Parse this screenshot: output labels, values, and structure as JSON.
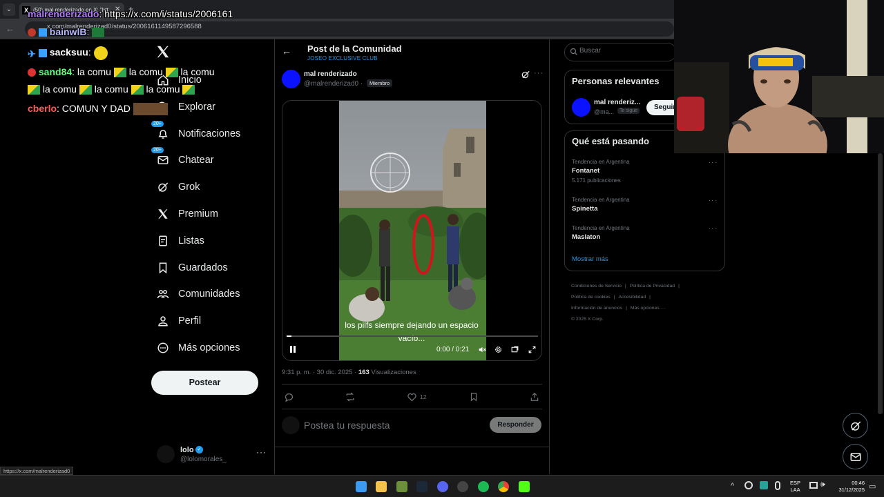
{
  "browser": {
    "tab_title": "(50) mal renderizado en X: \"htt",
    "tab_close": "✕",
    "tab_new": "+",
    "tab_menu": "⌄",
    "url": "x.com/malrenderizad0/status/2006161149587296588",
    "status_url": "https://x.com/malrenderizad0"
  },
  "chat": [
    {
      "user": "malrenderizado",
      "color": "#b57cff",
      "text": ": https://x.com/i/status/2006161"
    },
    {
      "user": "bainwlB",
      "color": "#b8b8ff",
      "text": ":"
    },
    {
      "user": "sacksuu",
      "color": "#ffffff",
      "text": ":"
    },
    {
      "user": "sand84",
      "color": "#5eff7a",
      "text": ": la comu",
      "repeat": [
        "la comu",
        "la comu"
      ]
    },
    {
      "user": "",
      "color": "#ffffff",
      "text": "la comu",
      "repeat": [
        "la comu",
        "la comu"
      ]
    },
    {
      "user": "cberlo",
      "color": "#ff5a5a",
      "text": ": COMUN Y DAD"
    }
  ],
  "nav": {
    "items": [
      {
        "label": "Inicio",
        "icon": "home-icon"
      },
      {
        "label": "Explorar",
        "icon": "explore-icon"
      },
      {
        "label": "Notificaciones",
        "icon": "bell-icon",
        "badge": "20+"
      },
      {
        "label": "Chatear",
        "icon": "mail-icon",
        "badge": "20+"
      },
      {
        "label": "Grok",
        "icon": "grok-icon"
      },
      {
        "label": "Premium",
        "icon": "x-premium-icon"
      },
      {
        "label": "Listas",
        "icon": "list-icon"
      },
      {
        "label": "Guardados",
        "icon": "bookmark-icon"
      },
      {
        "label": "Comunidades",
        "icon": "communities-icon"
      },
      {
        "label": "Perfil",
        "icon": "profile-icon"
      },
      {
        "label": "Más opciones",
        "icon": "more-options-icon"
      }
    ],
    "post_button": "Postear",
    "account": {
      "name": "lolo",
      "handle": "@lolomorales_",
      "more": "···"
    }
  },
  "header": {
    "back": "←",
    "title": "Post de la Comunidad",
    "subtitle": "JOSEO EXCLUSIVE CLUB"
  },
  "post": {
    "author": "mal renderizado",
    "handle": "@malrenderizad0 ·",
    "member_badge": "Miembro",
    "more": "···",
    "video": {
      "caption": "los pilfs siempre dejando un espacio vacío...",
      "time": "0:00 / 0:21",
      "progress": 0.02
    },
    "meta_time": "9:31 p. m. · 30 dic. 2025 · ",
    "views_count": "163",
    "views_label": " Visualizaciones",
    "likes": "12",
    "reply_placeholder": "Postea tu respuesta",
    "reply_button": "Responder"
  },
  "sidebar": {
    "search_placeholder": "Buscar",
    "relevant": {
      "title": "Personas relevantes",
      "name": "mal renderiz...",
      "handle": "@ma...",
      "follows_you": "Te sigue",
      "follow_button": "Seguir"
    },
    "trends": {
      "title": "Qué está pasando",
      "items": [
        {
          "context": "Tendencia en Argentina",
          "name": "Fontanet",
          "posts": "5.171 publicaciones"
        },
        {
          "context": "Tendencia en Argentina",
          "name": "Spinetta",
          "posts": ""
        },
        {
          "context": "Tendencia en Argentina",
          "name": "Maslaton",
          "posts": ""
        }
      ],
      "more": "···",
      "show_more": "Mostrar más"
    },
    "footer": {
      "links": [
        "Condiciones de Servicio",
        "Política de Privacidad",
        "Política de cookies",
        "Accesibilidad",
        "Información de anuncios",
        "Más opciones ···"
      ],
      "separator": "|",
      "copyright": "© 2025 X Corp."
    }
  },
  "taskbar": {
    "lang_top": "ESP",
    "lang_bottom": "LAA",
    "time": "00:46",
    "date": "31/12/2025",
    "tray_up": "^"
  },
  "colors": {
    "accent": "#1d9bf0",
    "avatar_blue": "#0a12ff",
    "background": "#000000",
    "text": "#e7e9ea",
    "muted": "#71767b"
  }
}
